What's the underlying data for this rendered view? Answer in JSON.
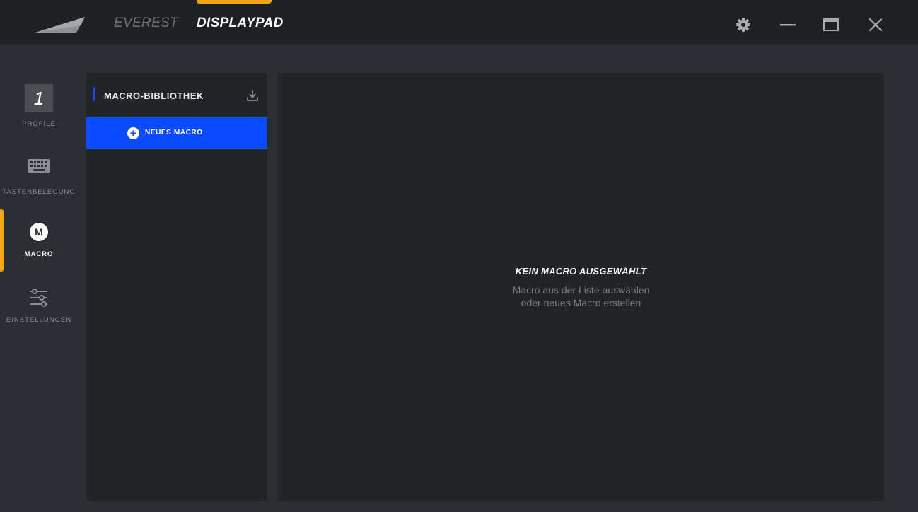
{
  "app": {
    "tabs": [
      {
        "label": "EVEREST"
      },
      {
        "label": "DISPLAYPAD"
      }
    ],
    "active_tab_color": "#f0a51b"
  },
  "window_controls": [
    "settings-icon",
    "minimize-icon",
    "maximize-icon",
    "close-icon"
  ],
  "sidebar": {
    "items": [
      {
        "label": "PROFILE",
        "value": "1",
        "icon": "profile-number"
      },
      {
        "label": "TASTENBELEGUNG",
        "icon": "keyboard-icon"
      },
      {
        "label": "MACRO",
        "icon": "macro-icon",
        "icon_letter": "M",
        "active": true
      },
      {
        "label": "EINSTELLUNGEN",
        "icon": "sliders-icon"
      }
    ]
  },
  "library": {
    "title": "MACRO-BIBLIOTHEK",
    "new_macro_label": "NEUES MACRO",
    "accent_color": "#1848ff",
    "button_color": "#0a4bff"
  },
  "detail": {
    "empty_title": "KEIN MACRO AUSGEWÄHLT",
    "empty_line1": "Macro aus der Liste auswählen",
    "empty_line2": "oder neues Macro erstellen"
  }
}
